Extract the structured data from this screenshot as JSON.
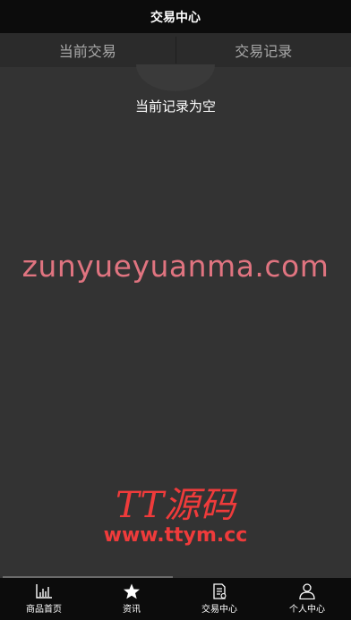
{
  "header": {
    "title": "交易中心"
  },
  "tabs": [
    {
      "label": "当前交易"
    },
    {
      "label": "交易记录"
    }
  ],
  "empty_state": {
    "text": "当前记录为空"
  },
  "watermarks": {
    "site_text": "zunyueyuanma.com",
    "logo_text": "TT源码",
    "logo_url": "www.ttym.cc"
  },
  "bottom_nav": {
    "items": [
      {
        "label": "商品首页",
        "icon": "chart-icon"
      },
      {
        "label": "资讯",
        "icon": "star-icon"
      },
      {
        "label": "交易中心",
        "icon": "document-icon"
      },
      {
        "label": "个人中心",
        "icon": "user-icon"
      }
    ]
  },
  "colors": {
    "background": "#333333",
    "header": "#0c0c0c",
    "tab_bar": "#2b2b2b",
    "watermark_pink": "#e07480",
    "watermark_red": "#ef3b3b"
  }
}
